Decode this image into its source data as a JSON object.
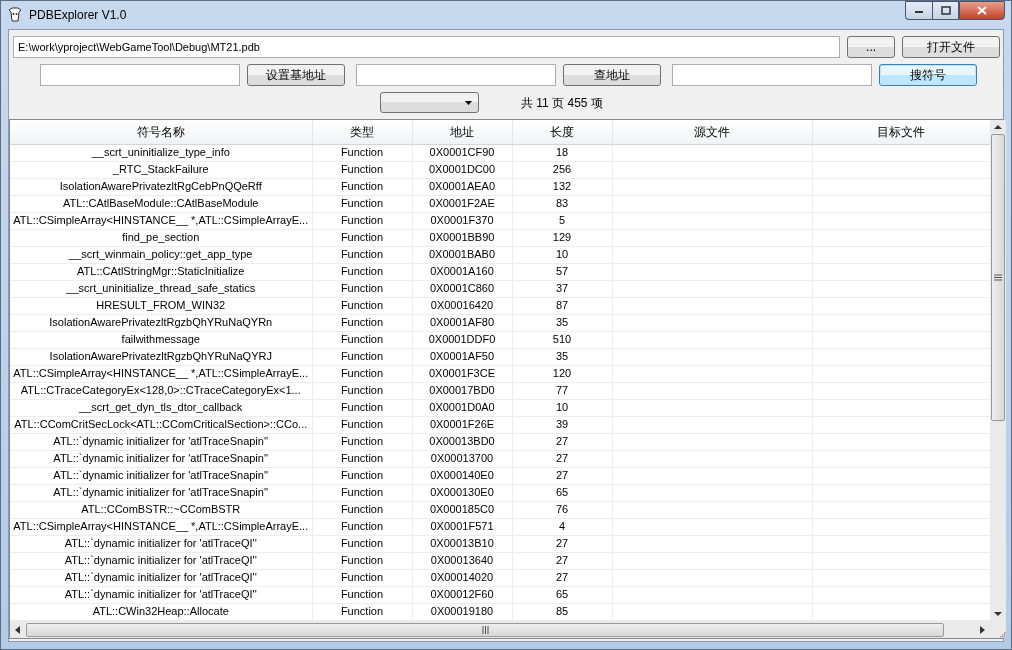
{
  "window": {
    "title": "PDBExplorer V1.0"
  },
  "path_field": {
    "value": "E:\\work\\yproject\\WebGameTool\\Debug\\MT21.pdb"
  },
  "file_buttons": [
    {
      "label": "...",
      "default": false
    },
    {
      "label": "打开文件",
      "default": false
    }
  ],
  "search_row": [
    {
      "button": {
        "label": "设置基地址",
        "default": false
      }
    },
    {
      "button": {
        "label": "查地址",
        "default": false
      }
    },
    {
      "button": {
        "label": "搜符号",
        "default": true
      }
    }
  ],
  "page_info": "共 11 页 455 项",
  "table": {
    "columns": [
      "符号名称",
      "类型",
      "地址",
      "长度",
      "源文件",
      "目标文件"
    ],
    "rows": [
      [
        "__scrt_uninitialize_type_info",
        "Function",
        "0X0001CF90",
        "18"
      ],
      [
        "_RTC_StackFailure",
        "Function",
        "0X0001DC00",
        "256"
      ],
      [
        "IsolationAwarePrivatezltRgCebPnQQeRff",
        "Function",
        "0X0001AEA0",
        "132"
      ],
      [
        "ATL::CAtlBaseModule::CAtlBaseModule",
        "Function",
        "0X0001F2AE",
        "83"
      ],
      [
        "ATL::CSimpleArray<HINSTANCE__ *,ATL::CSimpleArrayE...",
        "Function",
        "0X0001F370",
        "5"
      ],
      [
        "find_pe_section",
        "Function",
        "0X0001BB90",
        "129"
      ],
      [
        "__scrt_winmain_policy::get_app_type",
        "Function",
        "0X0001BAB0",
        "10"
      ],
      [
        "ATL::CAtlStringMgr::StaticInitialize",
        "Function",
        "0X0001A160",
        "57"
      ],
      [
        "__scrt_uninitialize_thread_safe_statics",
        "Function",
        "0X0001C860",
        "37"
      ],
      [
        "HRESULT_FROM_WIN32",
        "Function",
        "0X00016420",
        "87"
      ],
      [
        "IsolationAwarePrivatezltRgzbQhYRuNaQYRn",
        "Function",
        "0X0001AF80",
        "35"
      ],
      [
        "failwithmessage",
        "Function",
        "0X0001DDF0",
        "510"
      ],
      [
        "IsolationAwarePrivatezltRgzbQhYRuNaQYRJ",
        "Function",
        "0X0001AF50",
        "35"
      ],
      [
        "ATL::CSimpleArray<HINSTANCE__ *,ATL::CSimpleArrayE...",
        "Function",
        "0X0001F3CE",
        "120"
      ],
      [
        "ATL::CTraceCategoryEx<128,0>::CTraceCategoryEx<1...",
        "Function",
        "0X00017BD0",
        "77"
      ],
      [
        "__scrt_get_dyn_tls_dtor_callback",
        "Function",
        "0X0001D0A0",
        "10"
      ],
      [
        "ATL::CComCritSecLock<ATL::CComCriticalSection>::CCo...",
        "Function",
        "0X0001F26E",
        "39"
      ],
      [
        "ATL::`dynamic initializer for 'atlTraceSnapin''",
        "Function",
        "0X00013BD0",
        "27"
      ],
      [
        "ATL::`dynamic initializer for 'atlTraceSnapin''",
        "Function",
        "0X00013700",
        "27"
      ],
      [
        "ATL::`dynamic initializer for 'atlTraceSnapin''",
        "Function",
        "0X000140E0",
        "27"
      ],
      [
        "ATL::`dynamic initializer for 'atlTraceSnapin''",
        "Function",
        "0X000130E0",
        "65"
      ],
      [
        "ATL::CComBSTR::~CComBSTR",
        "Function",
        "0X000185C0",
        "76"
      ],
      [
        "ATL::CSimpleArray<HINSTANCE__ *,ATL::CSimpleArrayE...",
        "Function",
        "0X0001F571",
        "4"
      ],
      [
        "ATL::`dynamic initializer for 'atlTraceQI''",
        "Function",
        "0X00013B10",
        "27"
      ],
      [
        "ATL::`dynamic initializer for 'atlTraceQI''",
        "Function",
        "0X00013640",
        "27"
      ],
      [
        "ATL::`dynamic initializer for 'atlTraceQI''",
        "Function",
        "0X00014020",
        "27"
      ],
      [
        "ATL::`dynamic initializer for 'atlTraceQI''",
        "Function",
        "0X00012F60",
        "65"
      ],
      [
        "ATL::CWin32Heap::Allocate",
        "Function",
        "0X00019180",
        "85"
      ]
    ]
  }
}
